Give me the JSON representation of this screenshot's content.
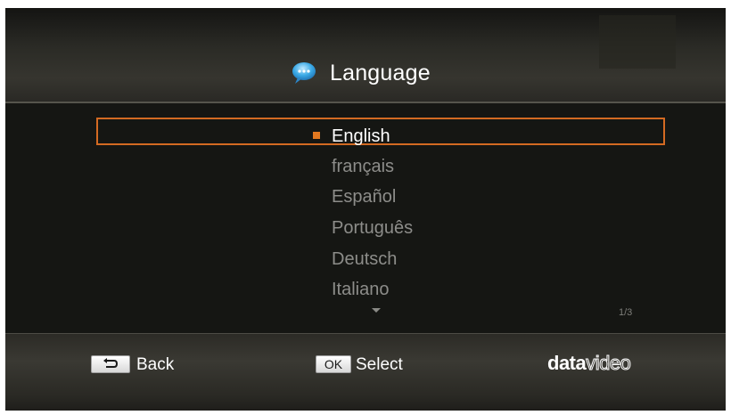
{
  "header": {
    "title": "Language",
    "icon": "speech-bubble-icon"
  },
  "languages": {
    "items": [
      {
        "label": "English",
        "selected": true
      },
      {
        "label": "français",
        "selected": false
      },
      {
        "label": "Español",
        "selected": false
      },
      {
        "label": "Português",
        "selected": false
      },
      {
        "label": "Deutsch",
        "selected": false
      },
      {
        "label": "Italiano",
        "selected": false
      }
    ],
    "page_indicator": "1/3"
  },
  "footer": {
    "back_label": "Back",
    "ok_key": "OK",
    "select_label": "Select",
    "logo_text_bold": "data",
    "logo_text_thin": "video"
  },
  "colors": {
    "accent": "#d36a22",
    "selected_text": "#ffffff",
    "unselected_text": "#8d8d8a"
  }
}
